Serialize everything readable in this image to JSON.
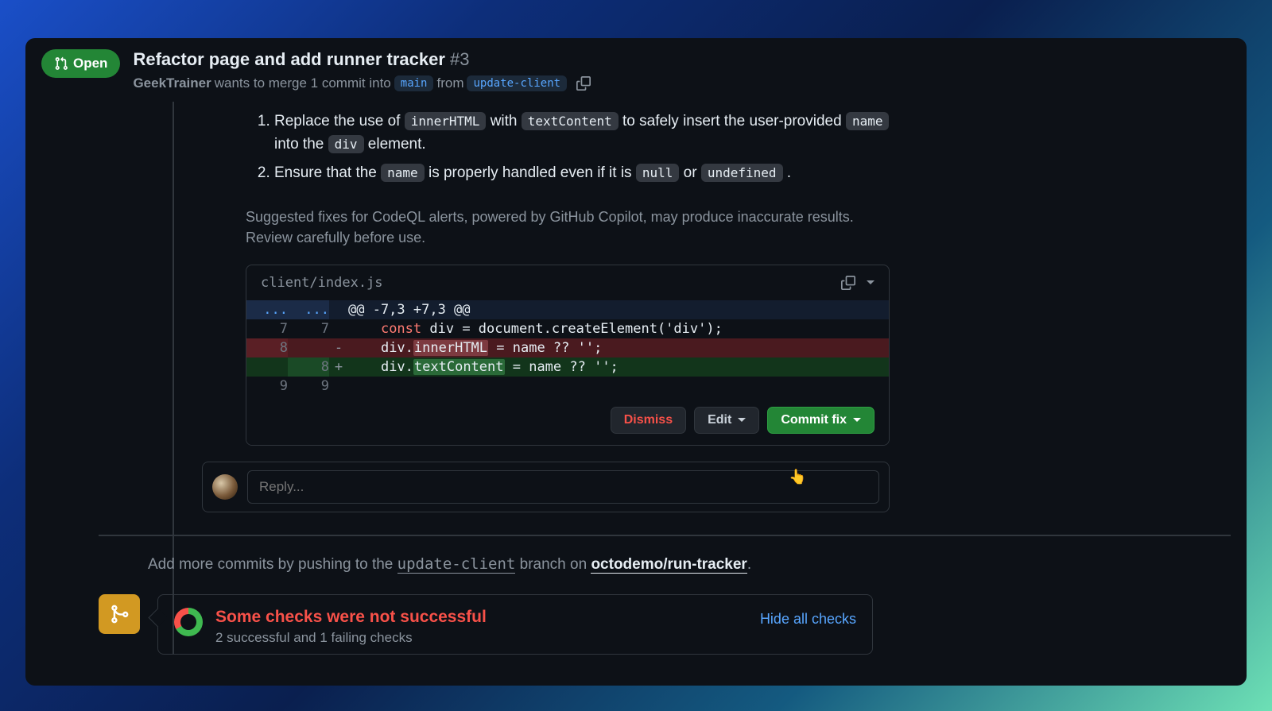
{
  "header": {
    "status": "Open",
    "title": "Refactor page and add runner tracker",
    "pr_number": "#3",
    "author": "GeekTrainer",
    "merge_text_1": "wants to merge 1 commit into",
    "base_branch": "main",
    "merge_text_2": "from",
    "head_branch": "update-client"
  },
  "fixes": {
    "item1_pre": "Replace the use of ",
    "item1_code1": "innerHTML",
    "item1_mid": " with ",
    "item1_code2": "textContent",
    "item1_post1": " to safely insert the user-provided ",
    "item1_code3": "name",
    "item1_post2": " into the ",
    "item1_code4": "div",
    "item1_post3": " element.",
    "item2_pre": "Ensure that the ",
    "item2_code1": "name",
    "item2_mid": " is properly handled even if it is ",
    "item2_code2": "null",
    "item2_or": " or ",
    "item2_code3": "undefined",
    "item2_end": " ."
  },
  "disclaimer": "Suggested fixes for CodeQL alerts, powered by GitHub Copilot, may produce inaccurate results. Review carefully before use.",
  "diff": {
    "filename": "client/index.js",
    "hunk_dots": "...",
    "hunk_header": "@@ -7,3 +7,3 @@",
    "rows": {
      "r1_old": "7",
      "r1_new": "7",
      "r1_code_kw": "const",
      "r1_code_rest": " div = document.createElement('div');",
      "r2_old": "8",
      "r2_new": "",
      "r2_sign": "-",
      "r2_pre": "div.",
      "r2_hl": "innerHTML",
      "r2_post": " = name ?? '';",
      "r3_old": "",
      "r3_new": "8",
      "r3_sign": "+",
      "r3_pre": "div.",
      "r3_hl": "textContent",
      "r3_post": " = name ?? '';",
      "r4_old": "9",
      "r4_new": "9"
    },
    "buttons": {
      "dismiss": "Dismiss",
      "edit": "Edit",
      "commit": "Commit fix"
    }
  },
  "reply": {
    "placeholder": "Reply..."
  },
  "push_hint": {
    "pre": "Add more commits by pushing to the ",
    "branch": "update-client",
    "mid": " branch on ",
    "repo": "octodemo/run-tracker",
    "end": "."
  },
  "checks": {
    "title": "Some checks were not successful",
    "subtitle": "2 successful and 1 failing checks",
    "hide": "Hide all checks"
  }
}
